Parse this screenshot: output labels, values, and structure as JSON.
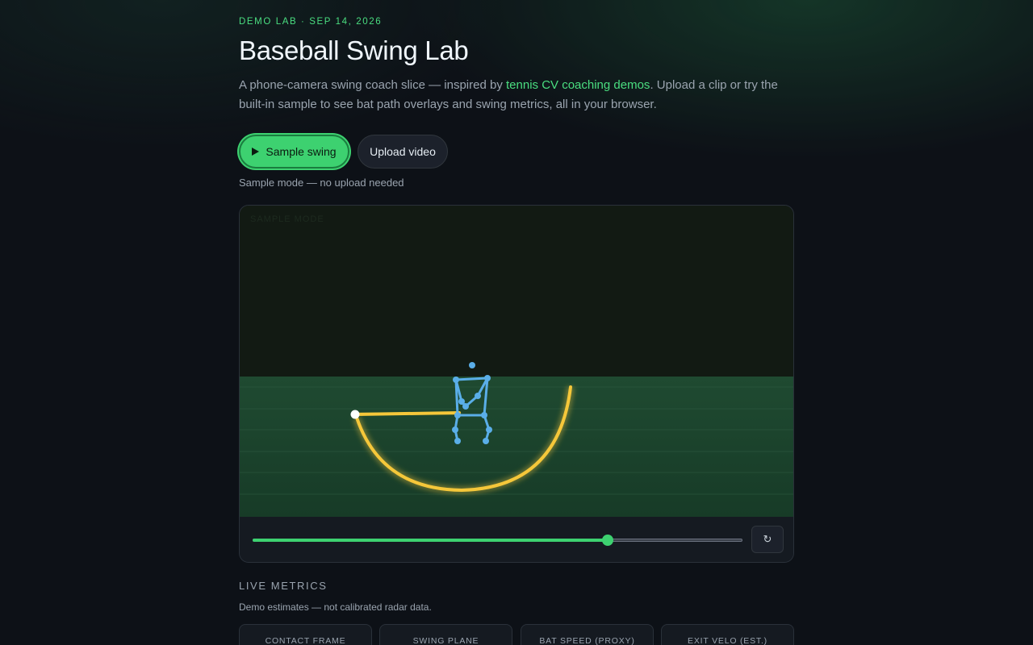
{
  "header": {
    "eyebrow": "DEMO LAB · SEP 14, 2026",
    "title": "Baseball Swing Lab",
    "intro_before": "A phone-camera swing coach slice — inspired by ",
    "intro_link": "tennis CV coaching demos",
    "intro_after": ". Upload a clip or try the built-in sample to see bat path overlays and swing metrics, all in your browser."
  },
  "actions": {
    "sample_label": "Sample swing",
    "upload_label": "Upload video",
    "mode_note": "Sample mode — no upload needed"
  },
  "player": {
    "tag": "SAMPLE MODE",
    "progress": 0.725,
    "replay_icon": "↻"
  },
  "metrics": {
    "title": "LIVE METRICS",
    "note": "Demo estimates — not calibrated radar data.",
    "cards": [
      {
        "label": "CONTACT FRAME"
      },
      {
        "label": "SWING PLANE"
      },
      {
        "label": "BAT SPEED (PROXY)"
      },
      {
        "label": "EXIT VELO (EST.)"
      }
    ]
  },
  "colors": {
    "accent": "#3dd170",
    "bat_path": "#f5c73a",
    "skeleton": "#5aaee8"
  }
}
